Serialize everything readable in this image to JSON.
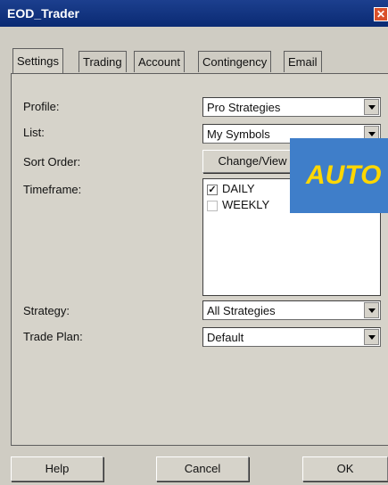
{
  "window": {
    "title": "EOD_Trader",
    "close_glyph": "✕"
  },
  "tabs": [
    {
      "label": "Settings",
      "active": true
    },
    {
      "label": "Trading"
    },
    {
      "label": "Account"
    },
    {
      "label": "Contingency"
    },
    {
      "label": "Email"
    }
  ],
  "settings": {
    "profile": {
      "label": "Profile:",
      "value": "Pro Strategies"
    },
    "list": {
      "label": "List:",
      "value": "My Symbols"
    },
    "sort_order": {
      "label": "Sort Order:",
      "button": "Change/View"
    },
    "timeframe": {
      "label": "Timeframe:",
      "options": [
        {
          "label": "DAILY",
          "checked": true
        },
        {
          "label": "WEEKLY",
          "checked": false
        }
      ]
    },
    "strategy": {
      "label": "Strategy:",
      "value": "All Strategies"
    },
    "trade_plan": {
      "label": "Trade Plan:",
      "value": "Default"
    }
  },
  "overlay_banner": "AUTO",
  "buttons": {
    "help": "Help",
    "cancel": "Cancel",
    "ok": "OK"
  },
  "colors": {
    "titlebar": "#0a2a73",
    "banner_bg": "#3f7ec9",
    "banner_text": "#ffd700"
  }
}
